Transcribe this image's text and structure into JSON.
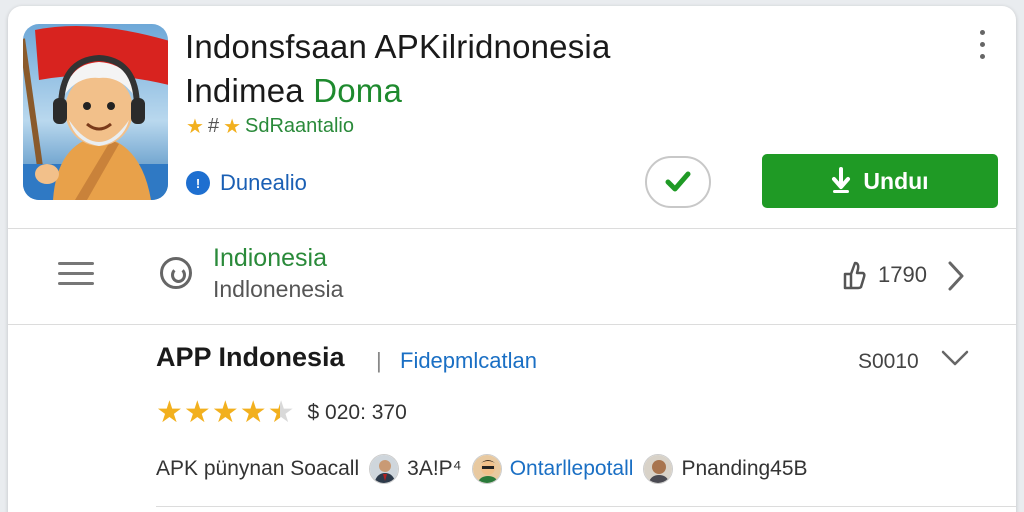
{
  "header": {
    "title_line1": "Indonsfsaan APKilridnonesia",
    "title_line2_main": "Indimea",
    "title_line2_accent": "Doma",
    "rating_hash": "#",
    "rating_label": "SdRaantalio",
    "developer_label": "Dunealio",
    "install_label": "Unduı"
  },
  "category": {
    "title": "Indionesia",
    "subtitle": "Indlonenesia",
    "like_count": "1790"
  },
  "detail": {
    "app_name": "APP Indonesia",
    "separator": "|",
    "category_link": "Fidepmlcatlan",
    "size": "S0010",
    "rating_stars": 4.5,
    "price": "$ 020: 370"
  },
  "people": {
    "prefix": "APK pünynan Soacall",
    "person1": "3A!P⁴",
    "person2": "Ontarllepotall",
    "person3": "Pnanding45B"
  },
  "colors": {
    "accent_green": "#1f9a25",
    "link_blue": "#1a6fc4",
    "star_gold": "#f2b01e"
  },
  "icons": [
    "app-mascot-icon",
    "more-vert-icon",
    "star-icon",
    "developer-badge-icon",
    "check-icon",
    "download-icon",
    "menu-icon",
    "category-icon",
    "thumb-up-icon",
    "chevron-right-icon",
    "chevron-down-icon",
    "avatar"
  ]
}
